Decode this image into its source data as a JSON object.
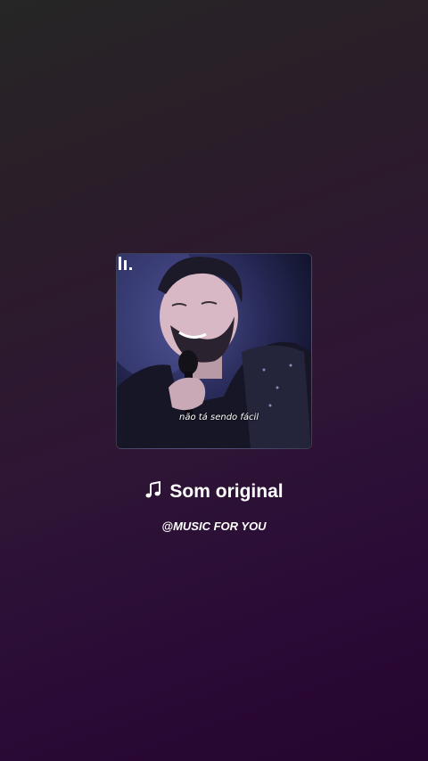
{
  "track": {
    "title": "Som original",
    "artist": "@MUSIC FOR YOU",
    "icon": "music-note-icon"
  },
  "cover": {
    "caption": "não tá sendo fácil",
    "logo_icon": "brand-bars-logo"
  },
  "colors": {
    "background_top": "#262626",
    "background_bottom": "#24062f",
    "text": "#ffffff"
  }
}
